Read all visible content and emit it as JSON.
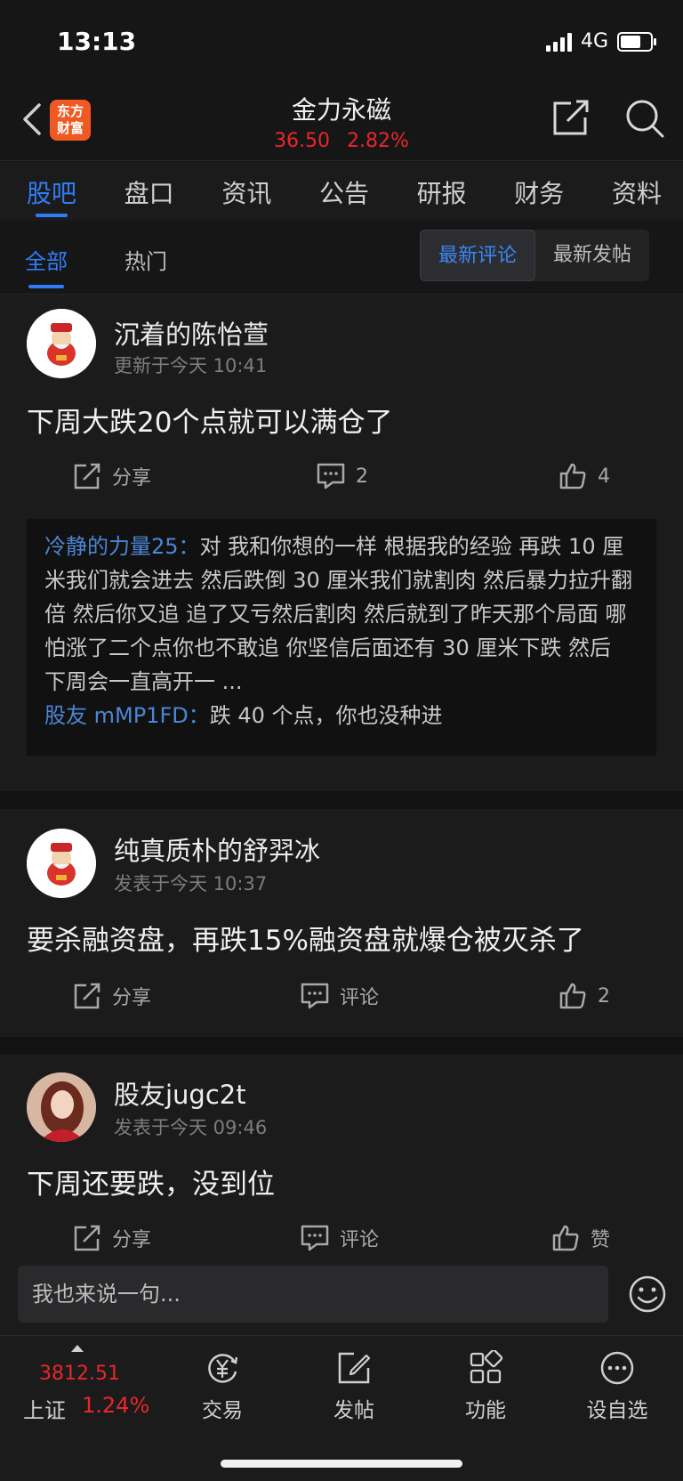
{
  "status": {
    "time": "13:13",
    "network": "4G"
  },
  "header": {
    "logo_line1": "东方",
    "logo_line2": "财富",
    "title": "金力永磁",
    "price": "36.50",
    "change": "2.82%"
  },
  "tabs": [
    "股吧",
    "盘口",
    "资讯",
    "公告",
    "研报",
    "财务",
    "资料"
  ],
  "filters": {
    "all": "全部",
    "hot": "热门",
    "latest_comment": "最新评论",
    "latest_post": "最新发帖"
  },
  "posts": [
    {
      "user": "沉着的陈怡萱",
      "time": "更新于今天 10:41",
      "text": "下周大跌20个点就可以满仓了",
      "share": "分享",
      "comments": "2",
      "likes": "4",
      "replies": [
        {
          "who": "冷静的力量25：",
          "text": "对 我和你想的一样 根据我的经验 再跌 10 厘米我们就会进去 然后跌倒 30 厘米我们就割肉 然后暴力拉升翻倍 然后你又追 追了又亏然后割肉 然后就到了昨天那个局面 哪怕涨了二个点你也不敢追 你坚信后面还有 30 厘米下跌 然后 下周会一直高开一 ..."
        },
        {
          "who": "股友 mMP1FD：",
          "text": "跌 40 个点，你也没种进"
        }
      ]
    },
    {
      "user": "纯真质朴的舒羿冰",
      "time": "发表于今天 10:37",
      "text": "要杀融资盘，再跌15%融资盘就爆仓被灭杀了",
      "share": "分享",
      "comments": "评论",
      "likes": "2"
    },
    {
      "user": "股友jugc2t",
      "time": "发表于今天 09:46",
      "text": "下周还要跌，没到位",
      "share": "分享",
      "comments": "评论",
      "likes": "赞"
    }
  ],
  "input": {
    "placeholder": "我也来说一句..."
  },
  "bottom": {
    "index_value": "3812.51",
    "index_name": "上证",
    "index_change": "1.24%",
    "trade": "交易",
    "post": "发帖",
    "functions": "功能",
    "watchlist": "设自选"
  },
  "colors": {
    "accent": "#2f7df6",
    "up": "#e8262c",
    "brand": "#f05a22"
  }
}
